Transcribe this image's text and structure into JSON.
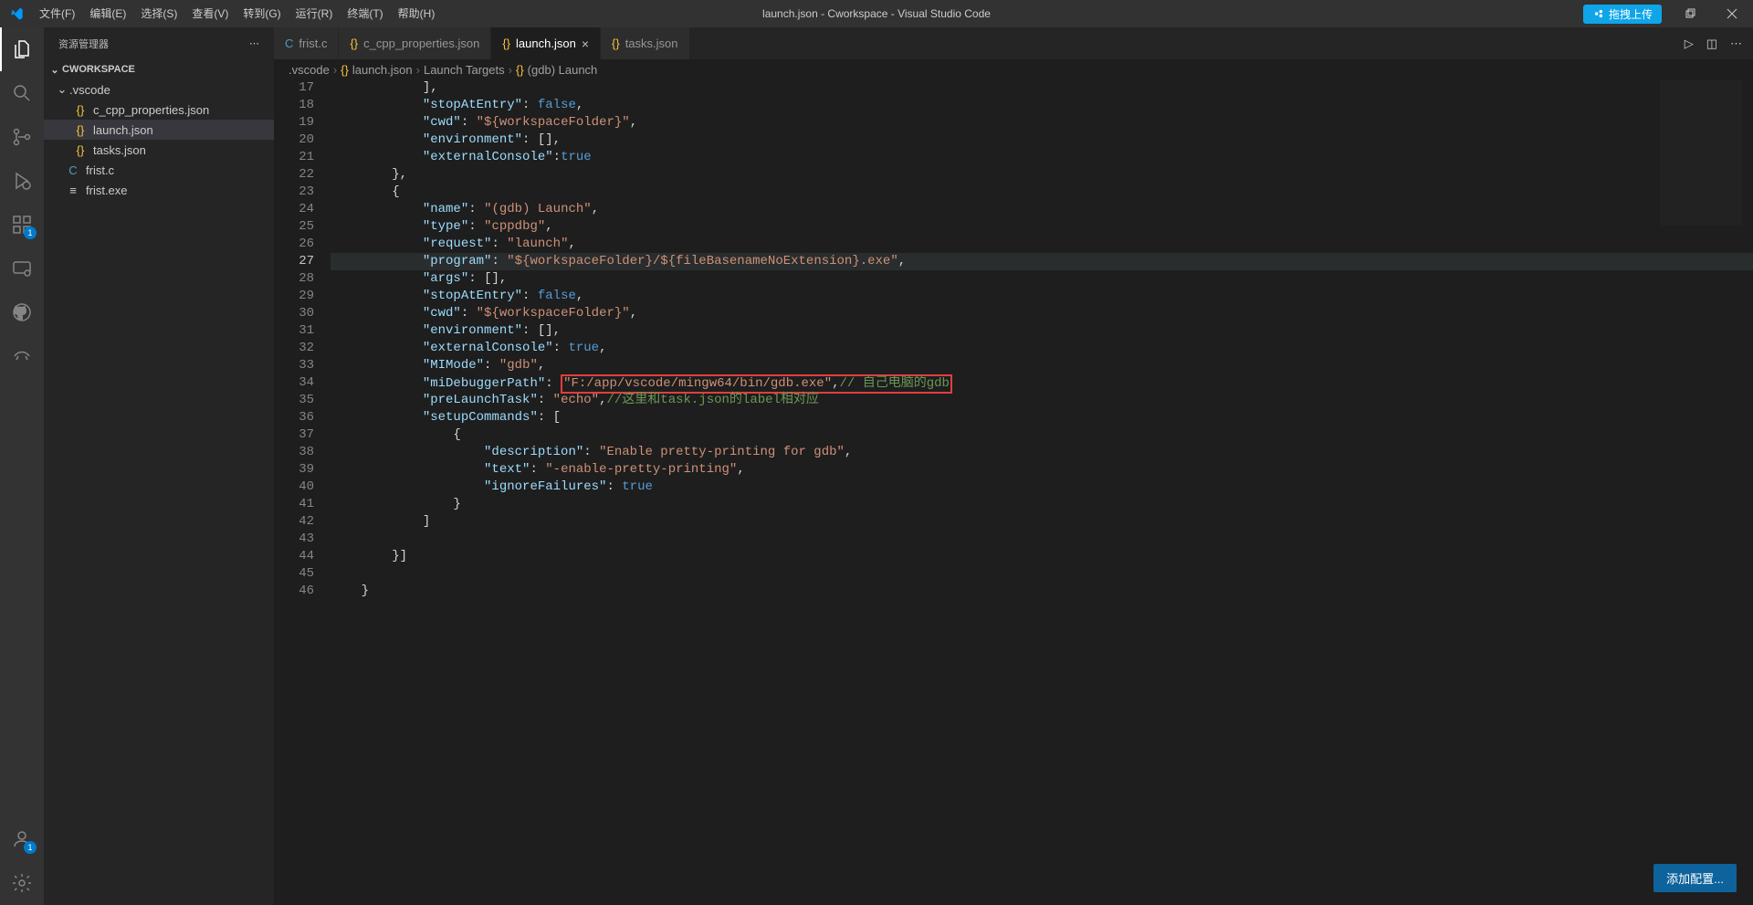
{
  "title": "launch.json - Cworkspace - Visual Studio Code",
  "menu": [
    "文件(F)",
    "编辑(E)",
    "选择(S)",
    "查看(V)",
    "转到(G)",
    "运行(R)",
    "终端(T)",
    "帮助(H)"
  ],
  "cloudButton": "拖拽上传",
  "sidebar": {
    "header": "资源管理器",
    "workspace": "CWORKSPACE",
    "folder": ".vscode",
    "files": [
      "c_cpp_properties.json",
      "launch.json",
      "tasks.json"
    ],
    "rootFiles": [
      {
        "name": "frist.c",
        "type": "c"
      },
      {
        "name": "frist.exe",
        "type": "exe"
      }
    ]
  },
  "tabs": [
    {
      "label": "frist.c",
      "icon": "c"
    },
    {
      "label": "c_cpp_properties.json",
      "icon": "json"
    },
    {
      "label": "launch.json",
      "icon": "json",
      "active": true,
      "closeable": true
    },
    {
      "label": "tasks.json",
      "icon": "json"
    }
  ],
  "breadcrumb": [
    ".vscode",
    "launch.json",
    "Launch Targets",
    "(gdb) Launch"
  ],
  "lineStart": 17,
  "lineEnd": 46,
  "currentLine": 27,
  "configButton": "添加配置...",
  "badge": "1",
  "code": {
    "l17": {
      "ind": "            ",
      "txt": "],"
    },
    "l18": {
      "ind": "            ",
      "key": "\"stopAtEntry\"",
      "sep": ": ",
      "val": "false",
      "comma": ","
    },
    "l19": {
      "ind": "            ",
      "key": "\"cwd\"",
      "sep": ": ",
      "str": "\"${workspaceFolder}\"",
      "comma": ","
    },
    "l20": {
      "ind": "            ",
      "key": "\"environment\"",
      "sep": ": ",
      "txt": "[],"
    },
    "l21": {
      "ind": "            ",
      "key": "\"externalConsole\"",
      "sep": ":",
      "val": "true"
    },
    "l22": {
      "ind": "        ",
      "txt": "},"
    },
    "l23": {
      "ind": "        ",
      "txt": "{"
    },
    "l24": {
      "ind": "            ",
      "key": "\"name\"",
      "sep": ": ",
      "str": "\"(gdb) Launch\"",
      "comma": ","
    },
    "l25": {
      "ind": "            ",
      "key": "\"type\"",
      "sep": ": ",
      "str": "\"cppdbg\"",
      "comma": ","
    },
    "l26": {
      "ind": "            ",
      "key": "\"request\"",
      "sep": ": ",
      "str": "\"launch\"",
      "comma": ","
    },
    "l27": {
      "ind": "            ",
      "key": "\"program\"",
      "sep": ": ",
      "str": "\"${workspaceFolder}/${fileBasenameNoExtension}.exe\"",
      "comma": ","
    },
    "l28": {
      "ind": "            ",
      "key": "\"args\"",
      "sep": ": ",
      "txt": "[],"
    },
    "l29": {
      "ind": "            ",
      "key": "\"stopAtEntry\"",
      "sep": ": ",
      "val": "false",
      "comma": ","
    },
    "l30": {
      "ind": "            ",
      "key": "\"cwd\"",
      "sep": ": ",
      "str": "\"${workspaceFolder}\"",
      "comma": ","
    },
    "l31": {
      "ind": "            ",
      "key": "\"environment\"",
      "sep": ": ",
      "txt": "[],"
    },
    "l32": {
      "ind": "            ",
      "key": "\"externalConsole\"",
      "sep": ": ",
      "val": "true",
      "comma": ","
    },
    "l33": {
      "ind": "            ",
      "key": "\"MIMode\"",
      "sep": ": ",
      "str": "\"gdb\"",
      "comma": ","
    },
    "l34": {
      "ind": "            ",
      "key": "\"miDebuggerPath\"",
      "sep": ": ",
      "str": "\"F:/app/vscode/mingw64/bin/gdb.exe\"",
      "comma": ",",
      "comment": "// 自己电脑的gdb"
    },
    "l35": {
      "ind": "            ",
      "key": "\"preLaunchTask\"",
      "sep": ": ",
      "str": "\"echo\"",
      "comma": ",",
      "comment": "//这里和task.json的label相对应"
    },
    "l36": {
      "ind": "            ",
      "key": "\"setupCommands\"",
      "sep": ": ",
      "txt": "["
    },
    "l37": {
      "ind": "                ",
      "txt": "{"
    },
    "l38": {
      "ind": "                    ",
      "key": "\"description\"",
      "sep": ": ",
      "str": "\"Enable pretty-printing for gdb\"",
      "comma": ","
    },
    "l39": {
      "ind": "                    ",
      "key": "\"text\"",
      "sep": ": ",
      "str": "\"-enable-pretty-printing\"",
      "comma": ","
    },
    "l40": {
      "ind": "                    ",
      "key": "\"ignoreFailures\"",
      "sep": ": ",
      "val": "true"
    },
    "l41": {
      "ind": "                ",
      "txt": "}"
    },
    "l42": {
      "ind": "            ",
      "txt": "]"
    },
    "l43": {
      "ind": "",
      "txt": ""
    },
    "l44": {
      "ind": "        ",
      "txt": "}]"
    },
    "l45": {
      "ind": "",
      "txt": ""
    },
    "l46": {
      "ind": "    ",
      "txt": "}"
    }
  }
}
